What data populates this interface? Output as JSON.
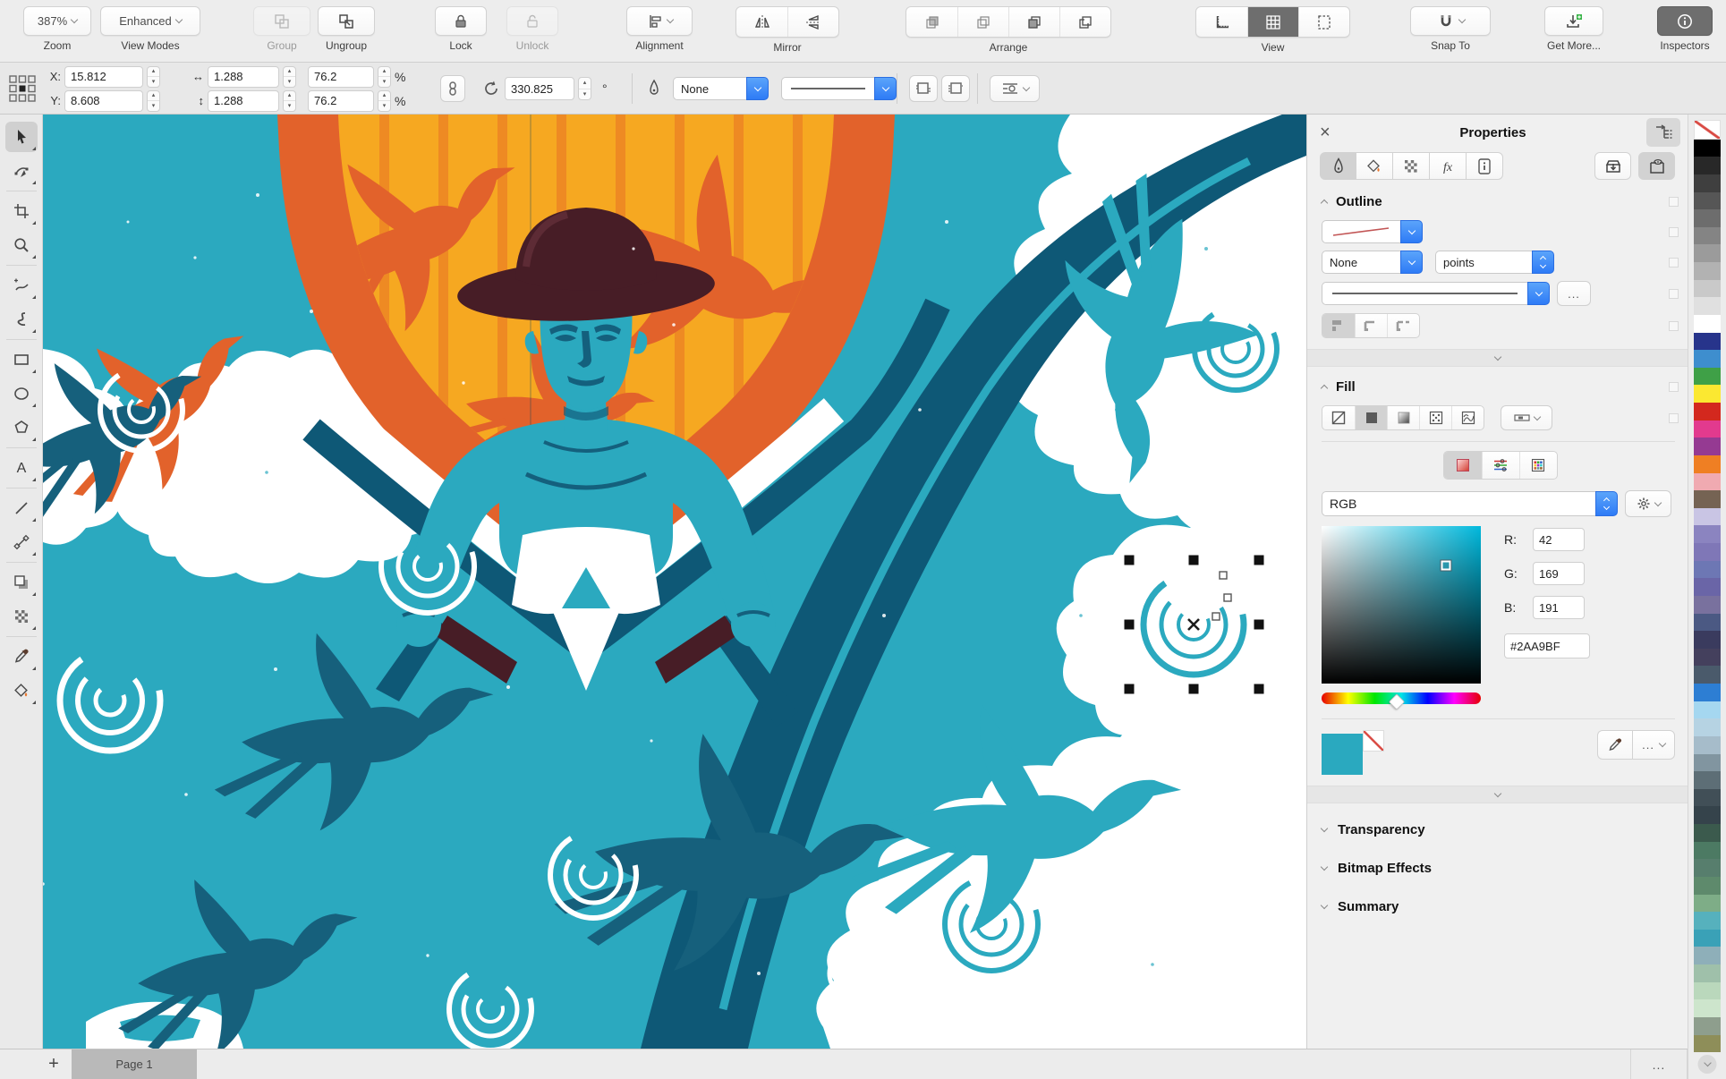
{
  "toolbar": {
    "zoom": {
      "value": "387%",
      "label": "Zoom"
    },
    "view_modes": {
      "value": "Enhanced",
      "label": "View Modes"
    },
    "group_label": "Group",
    "ungroup_label": "Ungroup",
    "lock_label": "Lock",
    "unlock_label": "Unlock",
    "alignment_label": "Alignment",
    "mirror_label": "Mirror",
    "arrange_label": "Arrange",
    "view_label": "View",
    "snap_to_label": "Snap To",
    "get_more_label": "Get More...",
    "inspectors_label": "Inspectors"
  },
  "property_bar": {
    "x_label": "X:",
    "x_value": "15.812",
    "y_label": "Y:",
    "y_value": "8.608",
    "width_value": "1.288",
    "height_value": "1.288",
    "scale_w": "76.2",
    "scale_h": "76.2",
    "percent": "%",
    "rotation": "330.825",
    "degree": "°",
    "outline_width": "None"
  },
  "panel": {
    "title": "Properties",
    "outline": {
      "title": "Outline",
      "width_value": "None",
      "units": "points",
      "more": "..."
    },
    "fill": {
      "title": "Fill",
      "color_model": "RGB",
      "r_label": "R:",
      "r_value": "42",
      "g_label": "G:",
      "g_value": "169",
      "b_label": "B:",
      "b_value": "191",
      "hex_value": "#2AA9BF",
      "more": "..."
    },
    "sections": {
      "transparency": "Transparency",
      "bitmap_effects": "Bitmap Effects",
      "summary": "Summary"
    }
  },
  "status_bar": {
    "add_page": "+",
    "page_tab": "Page 1",
    "more": "..."
  },
  "selected_fill": {
    "hex": "#2AA9BF",
    "r": 42,
    "g": 169,
    "b": 191
  },
  "ui_colors": {
    "accent_blue": "#3f8af5",
    "active_dark": "#6e6e6e",
    "canvas_teal": "#2BA9BF",
    "navy": "#0E5876",
    "dark_teal_bird": "#16607C",
    "shield_yellow": "#F6A821",
    "shield_orange": "#E2622B",
    "stripe_orange": "#EE8A23",
    "hat_maroon": "#471D26"
  },
  "palette": [
    "none",
    "#000000",
    "#282828",
    "#3f3f3f",
    "#565656",
    "#6d6d6d",
    "#848484",
    "#9b9b9b",
    "#b2b2b2",
    "#c9c9c9",
    "#e0e0e0",
    "#ffffff",
    "#27348b",
    "#3e8ece",
    "#3fa047",
    "#fbe831",
    "#d3281e",
    "#e23a8e",
    "#953a92",
    "#ef7f23",
    "#f0aab1",
    "#756353",
    "#c9c5e4",
    "#8b84c0",
    "#7f77b7",
    "#6d77b4",
    "#6a65a7",
    "#79719e",
    "#4b5983",
    "#3a3b5e",
    "#44405d",
    "#4a5a6b",
    "#2d7ed3",
    "#a5d7f0",
    "#b6d3e3",
    "#a6bcca",
    "#8195a0",
    "#5d6e76",
    "#414f57",
    "#35434b",
    "#3b5a4d",
    "#4c7a63",
    "#577e6d",
    "#5e8a6c",
    "#7ead87",
    "#56b1bd",
    "#3aa1b7",
    "#8eafb9",
    "#9fc0aa",
    "#bad8bc",
    "#cde5cc",
    "#8e9e8d",
    "#8e8e59"
  ]
}
